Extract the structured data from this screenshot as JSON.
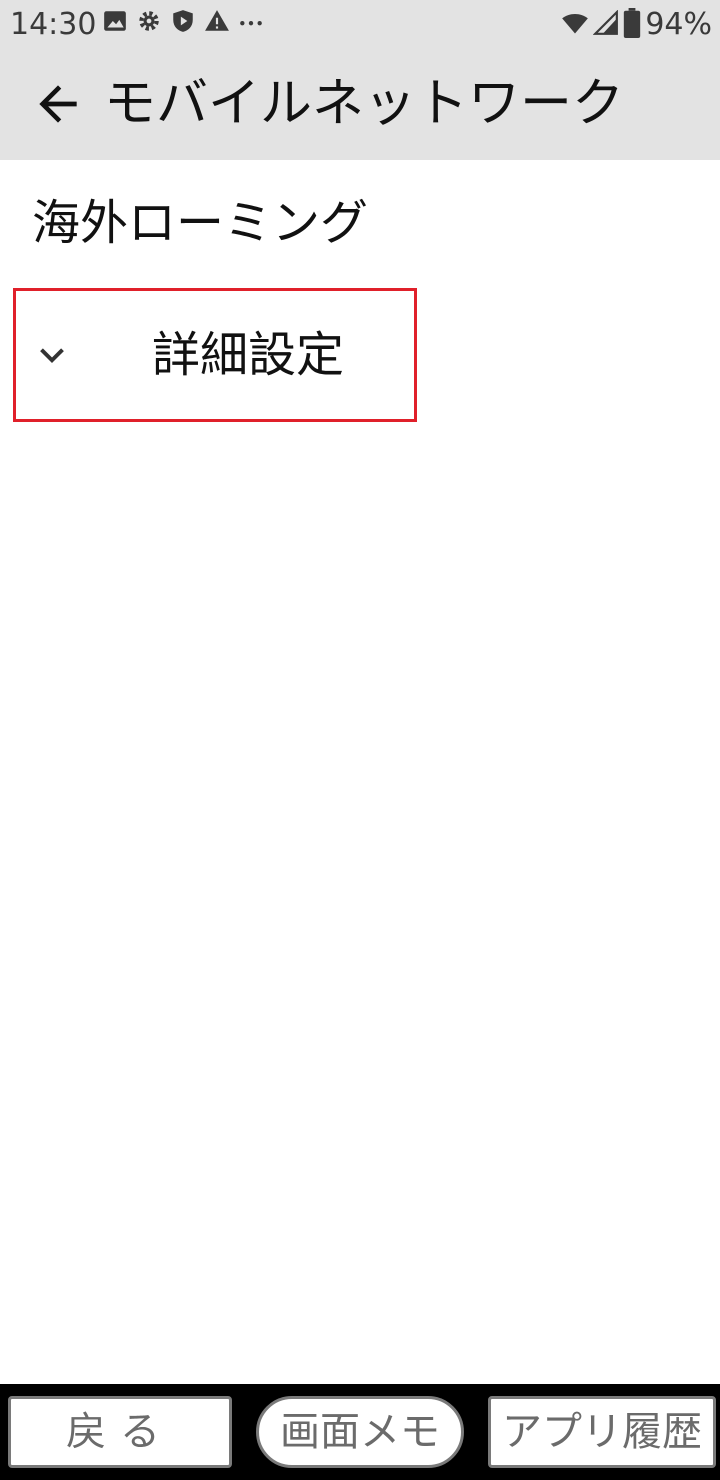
{
  "status_bar": {
    "time": "14:30",
    "icons": [
      "image-icon",
      "gear-icon",
      "shield-play-icon",
      "warning-icon",
      "more-dots-icon"
    ],
    "right_icons": [
      "wifi-icon",
      "cell-signal-icon",
      "battery-icon"
    ],
    "battery": "94%"
  },
  "app_bar": {
    "title": "モバイルネットワーク"
  },
  "list": {
    "roaming_label": "海外ローミング",
    "advanced_label": "詳細設定"
  },
  "bottom_bar": {
    "back_label": "戻る",
    "memo_label": "画面メモ",
    "history_label": "アプリ履歴"
  },
  "colors": {
    "header_bg": "#e3e3e3",
    "highlight_border": "#e0202a",
    "bottom_bar_bg": "#000000"
  }
}
